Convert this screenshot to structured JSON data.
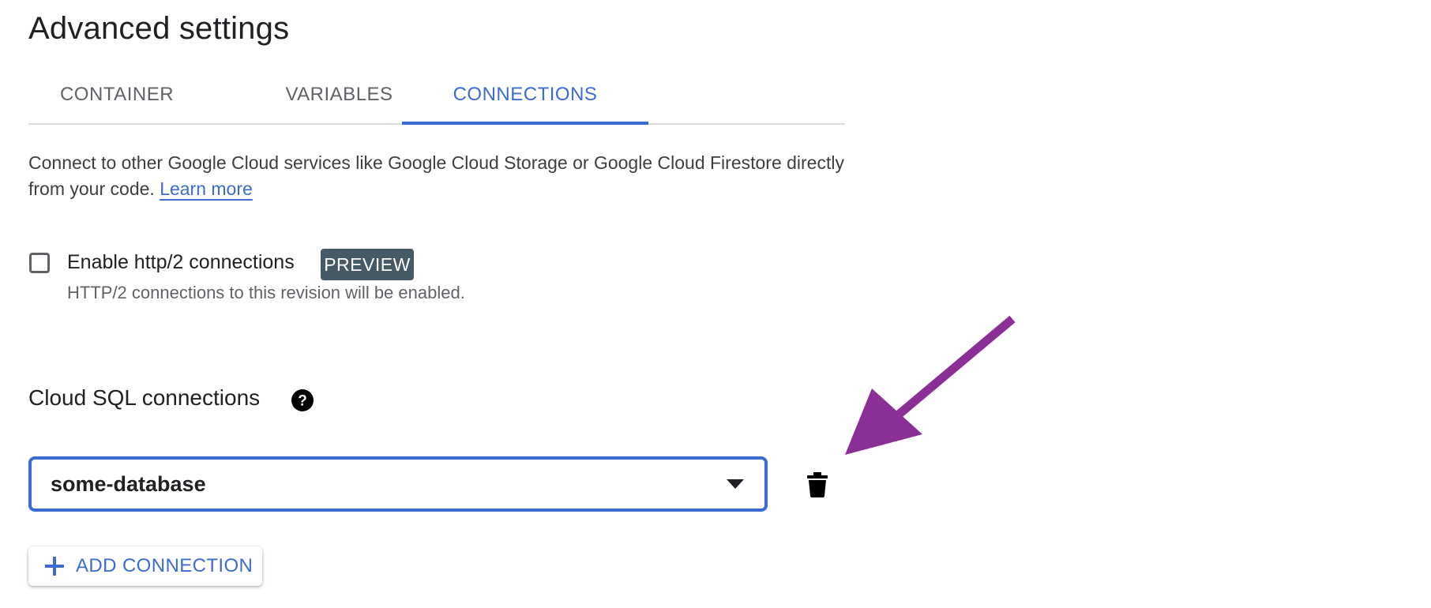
{
  "page": {
    "title": "Advanced settings"
  },
  "tabs": [
    {
      "label": "CONTAINER",
      "active": false
    },
    {
      "label": "VARIABLES",
      "active": false
    },
    {
      "label": "CONNECTIONS",
      "active": true
    }
  ],
  "description": {
    "text": "Connect to other Google Cloud services like Google Cloud Storage or Google Cloud Firestore directly from your code.",
    "link_label": "Learn more"
  },
  "http2": {
    "checkbox_label": "Enable http/2 connections",
    "checked": false,
    "badge": "PREVIEW",
    "hint": "HTTP/2 connections to this revision will be enabled."
  },
  "cloud_sql": {
    "title": "Cloud SQL connections",
    "help_icon": "help-circle-icon",
    "selected_value": "some-database",
    "dropdown_icon": "caret-down-icon",
    "delete_icon": "trash-icon",
    "add_button_label": "ADD CONNECTION",
    "add_icon": "plus-icon"
  },
  "colors": {
    "accent": "#3c6bd2",
    "badge_bg": "#455a64",
    "annotation_arrow": "#8a2f96"
  }
}
